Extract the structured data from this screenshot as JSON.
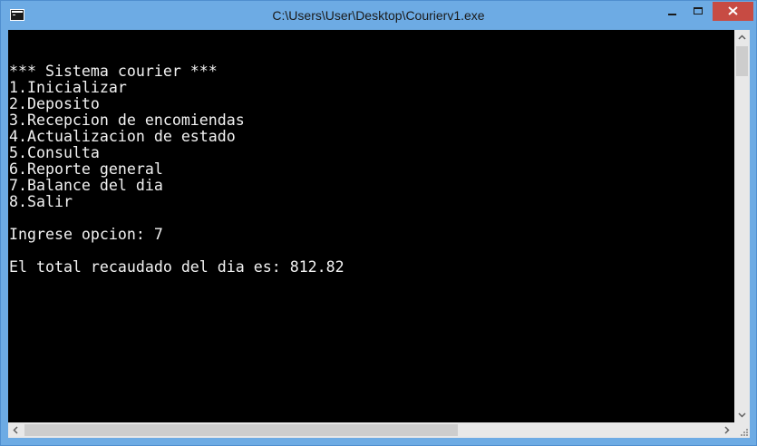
{
  "window": {
    "title": "C:\\Users\\User\\Desktop\\Courierv1.exe"
  },
  "console": {
    "lines": [
      "",
      "*** Sistema courier ***",
      "1.Inicializar",
      "2.Deposito",
      "3.Recepcion de encomiendas",
      "4.Actualizacion de estado",
      "5.Consulta",
      "6.Reporte general",
      "7.Balance del dia",
      "8.Salir",
      "",
      "Ingrese opcion: 7",
      "",
      "El total recaudado del dia es: 812.82"
    ]
  },
  "colors": {
    "titlebar": "#6dabe4",
    "close_button": "#c74b43",
    "console_bg": "#000000",
    "console_fg": "#f2f2f2"
  },
  "icons": {
    "app": "console-app-icon",
    "minimize": "minimize-icon",
    "maximize": "maximize-icon",
    "close": "close-icon"
  }
}
